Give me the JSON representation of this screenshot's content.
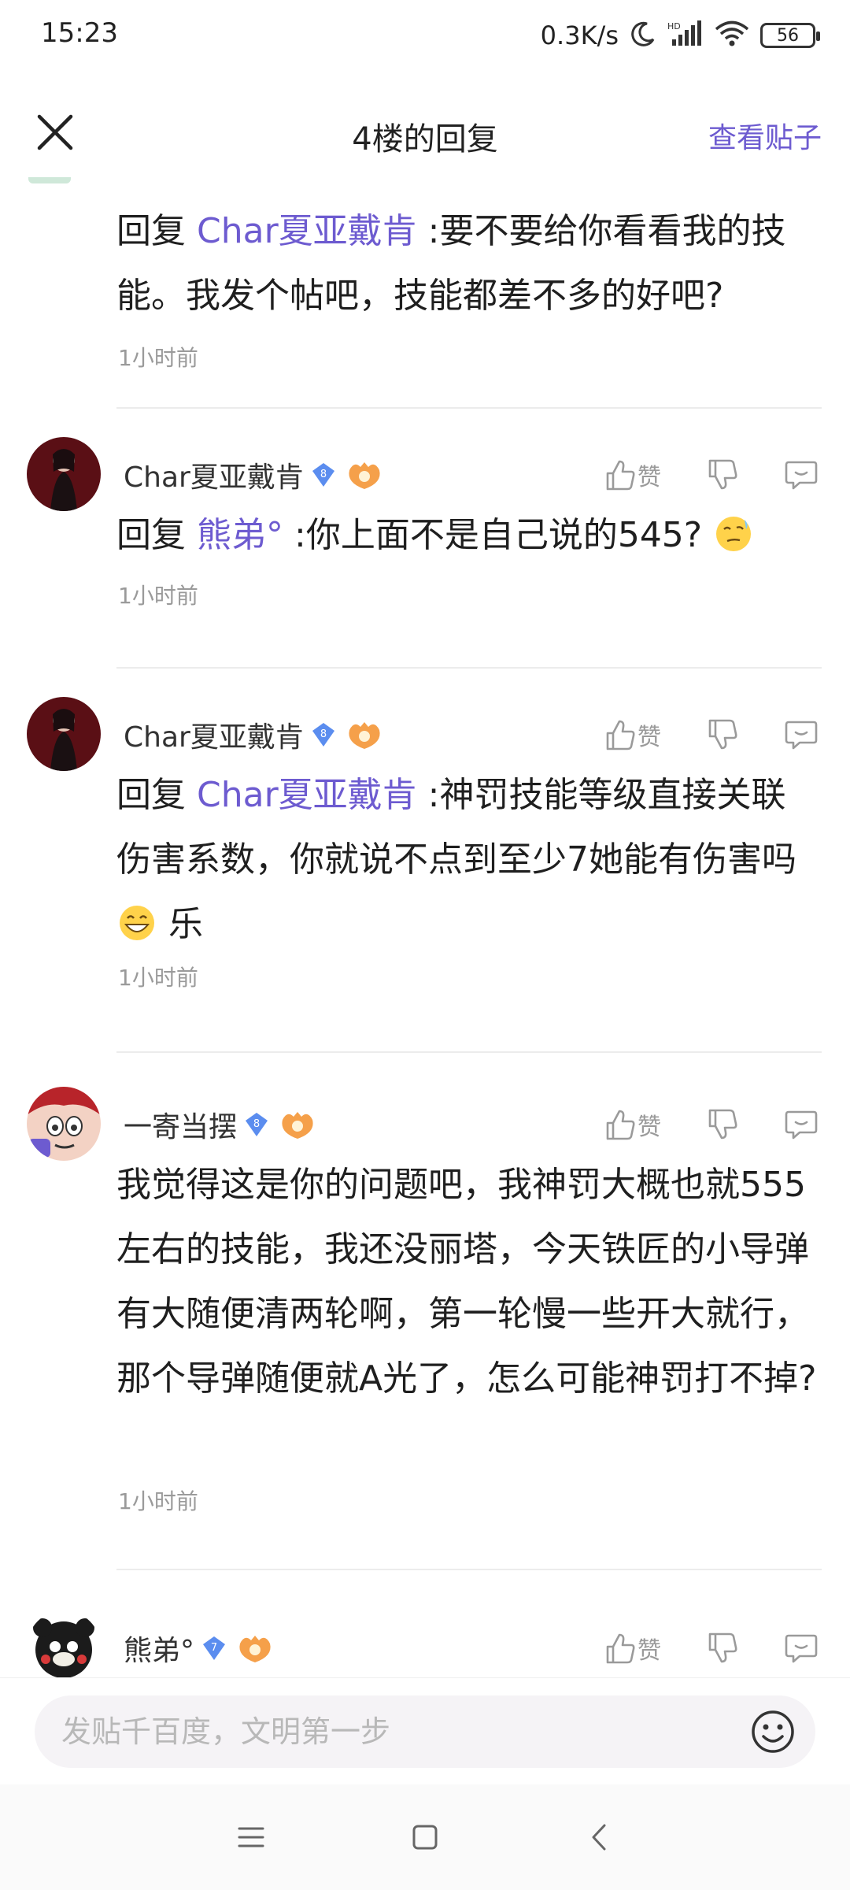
{
  "status_bar": {
    "time": "15:23",
    "net_speed": "0.3K/s",
    "hd_label": "HD",
    "battery": "56"
  },
  "nav": {
    "title": "4楼的回复",
    "view_post": "查看贴子"
  },
  "like_label": "赞",
  "replies": [
    {
      "prefix": "回复",
      "mention": "Char夏亚戴肯",
      "text": ":要不要给你看看我的技能。我发个帖吧，技能都差不多的好吧?",
      "time": "1小时前"
    },
    {
      "username": "Char夏亚戴肯",
      "level": "8",
      "prefix": "回复",
      "mention": "熊弟°",
      "text": ":你上面不是自己说的545?",
      "emoji": "thinking-face",
      "time": "1小时前"
    },
    {
      "username": "Char夏亚戴肯",
      "level": "8",
      "prefix": "回复",
      "mention": "Char夏亚戴肯",
      "text": ":神罚技能等级直接关联伤害系数，你就说不点到至少7她能有伤害吗",
      "emoji": "grinning-face",
      "text_after": "乐",
      "time": "1小时前"
    },
    {
      "username": "一寄当摆",
      "level": "8",
      "text": "我觉得这是你的问题吧，我神罚大概也就555左右的技能，我还没丽塔，今天铁匠的小导弹有大随便清两轮啊，第一轮慢一些开大就行，那个导弹随便就A光了，怎么可能神罚打不掉?",
      "time": "1小时前"
    },
    {
      "username": "熊弟°",
      "level": "7"
    }
  ],
  "input": {
    "placeholder": "发贴千百度，文明第一步"
  },
  "colors": {
    "accent": "#6d5bd0",
    "muted": "#9a9a9a",
    "level_badge": "#5b8def"
  }
}
